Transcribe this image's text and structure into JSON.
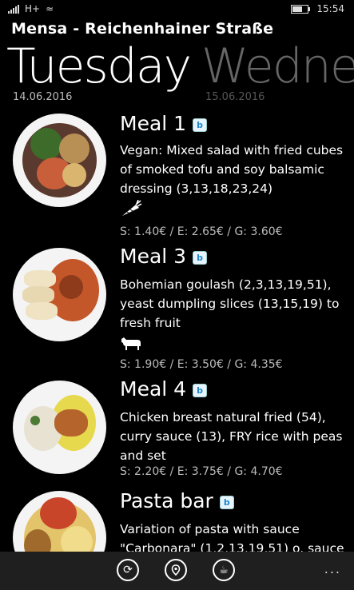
{
  "status": {
    "network": "H+",
    "time": "15:54"
  },
  "app": {
    "title": "Mensa - Reichenhainer Straße"
  },
  "pivot": {
    "active_day": "Tuesday",
    "active_date": "14.06.2016",
    "next_day": "Wedne",
    "next_date": "15.06.2016"
  },
  "meals": [
    {
      "name": "Meal 1",
      "badge": "b",
      "description": "Vegan: Mixed salad with fried cubes of smoked tofu and soy balsamic dressing (3,13,18,23,24)",
      "icon": "carrot-icon",
      "price": "S: 1.40€ / E: 2.65€ / G: 3.60€"
    },
    {
      "name": "Meal 3",
      "badge": "b",
      "description": "Bohemian goulash (2,3,13,19,51), yeast dumpling slices (13,15,19) to fresh fruit",
      "icon": "cow-icon",
      "price": "S: 1.90€ / E: 3.50€ / G: 4.35€"
    },
    {
      "name": "Meal 4",
      "badge": "b",
      "description": "Chicken breast natural fried (54), curry sauce (13), FRY rice with peas and set",
      "price": "S: 2.20€ / E: 3.75€ / G: 4.70€"
    },
    {
      "name": "Pasta bar",
      "badge": "b",
      "description": "Variation of pasta with sauce \"Carbonara\" (1,2,13,19,51) o. sauce"
    }
  ],
  "appbar": {
    "more": "..."
  }
}
